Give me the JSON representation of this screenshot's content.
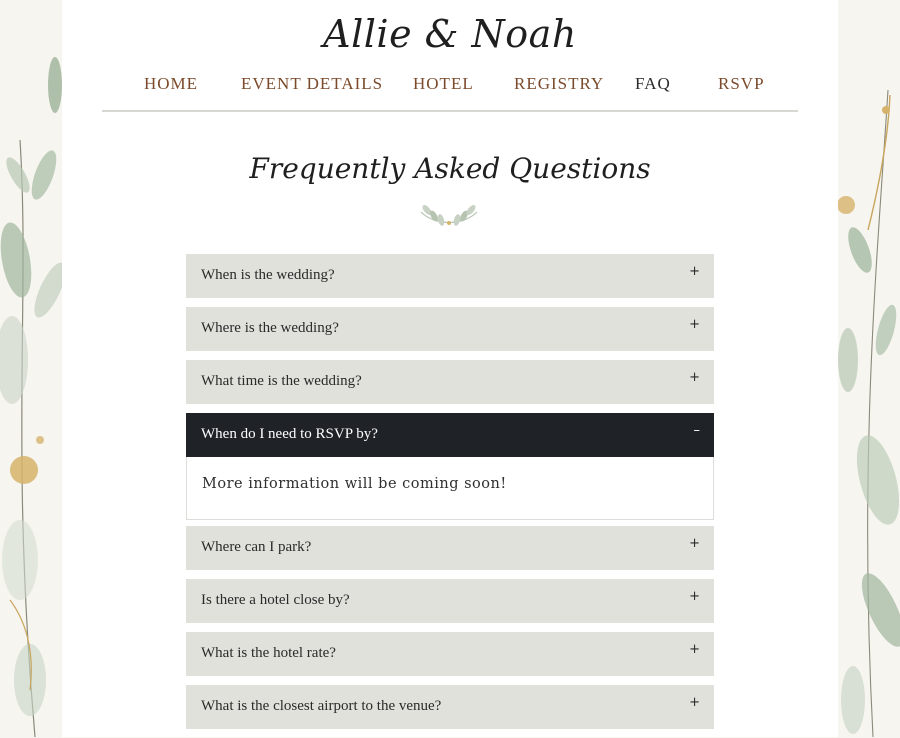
{
  "site": {
    "title": "Allie & Noah"
  },
  "nav": {
    "items": [
      {
        "label": "HOME",
        "active": false
      },
      {
        "label": "EVENT DETAILS",
        "active": false
      },
      {
        "label": "HOTEL",
        "active": false
      },
      {
        "label": "REGISTRY",
        "active": false
      },
      {
        "label": "FAQ",
        "active": true
      },
      {
        "label": "RSVP",
        "active": false
      }
    ]
  },
  "faq": {
    "title": "Frequently Asked Questions",
    "items": [
      {
        "question": "When is the wedding?",
        "sign": "+",
        "open": false
      },
      {
        "question": "Where is the wedding?",
        "sign": "+",
        "open": false
      },
      {
        "question": "What time is the wedding?",
        "sign": "+",
        "open": false
      },
      {
        "question": "When do I need to RSVP by?",
        "sign": "–",
        "open": true,
        "answer": "More information will be coming soon!"
      },
      {
        "question": "Where can I park?",
        "sign": "+",
        "open": false
      },
      {
        "question": "Is there a hotel close by?",
        "sign": "+",
        "open": false
      },
      {
        "question": "What is the hotel rate?",
        "sign": "+",
        "open": false
      },
      {
        "question": "What is the closest airport to the venue?",
        "sign": "+",
        "open": false
      }
    ]
  },
  "colors": {
    "nav_link": "#7a4a2b",
    "nav_active": "#2a2a2a",
    "question_bg": "#e1e1dc",
    "question_open_bg": "#1f2227"
  },
  "icons": {
    "decor_left": "eucalyptus-watercolor-icon",
    "decor_right": "eucalyptus-watercolor-icon",
    "divider": "leaf-sprig-icon"
  }
}
